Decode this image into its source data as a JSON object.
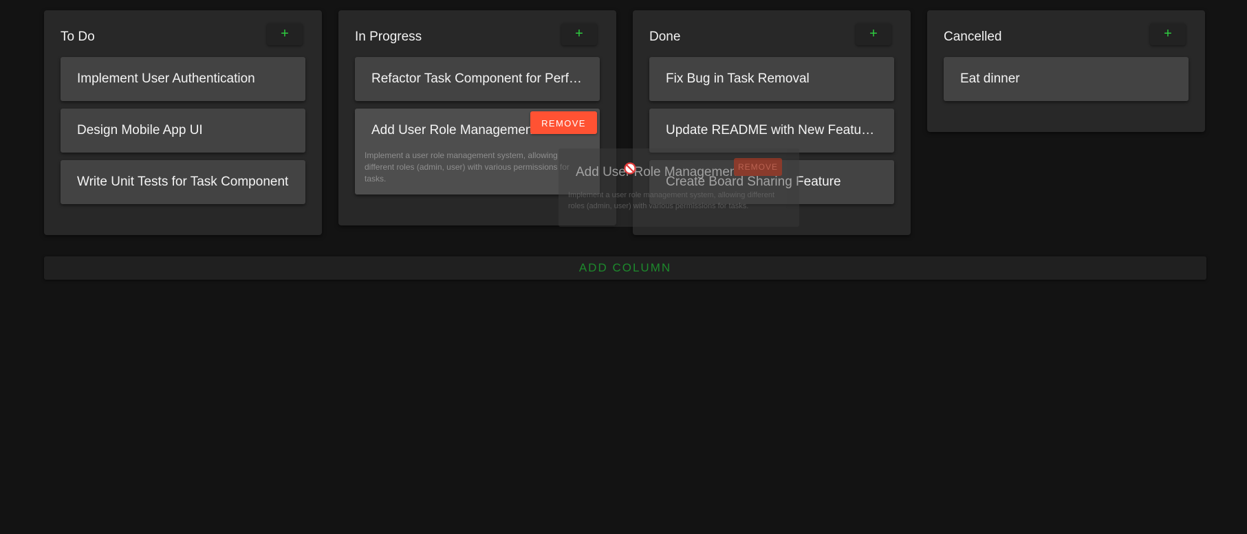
{
  "columns": [
    {
      "title": "To Do",
      "add_label": "+",
      "cards": [
        {
          "title": "Implement User Authentication"
        },
        {
          "title": "Design Mobile App UI"
        },
        {
          "title": "Write Unit Tests for Task Component"
        }
      ]
    },
    {
      "title": "In Progress",
      "add_label": "+",
      "cards": [
        {
          "title": "Refactor Task Component for Performance"
        },
        {
          "title": "Add User Role Management",
          "description": "Implement a user role management system, allowing different roles (admin, user) with various permissions for tasks.",
          "remove_label": "REMOVE"
        }
      ]
    },
    {
      "title": "Done",
      "add_label": "+",
      "cards": [
        {
          "title": "Fix Bug in Task Removal"
        },
        {
          "title": "Update README with New Features"
        },
        {
          "title": "Create Board Sharing Feature"
        }
      ]
    },
    {
      "title": "Cancelled",
      "add_label": "+",
      "cards": [
        {
          "title": "Eat dinner"
        }
      ]
    }
  ],
  "add_column_label": "ADD COLUMN",
  "drag_ghost": {
    "title": "Add User Role Management",
    "remove_label": "REMOVE",
    "description": "Implement a user role management system, allowing different roles (admin, user) with various permissions for tasks."
  },
  "colors": {
    "background": "#131313",
    "column": "#282828",
    "card": "#434343",
    "accent_green": "#2ecc40",
    "remove_red": "#ff5233"
  }
}
